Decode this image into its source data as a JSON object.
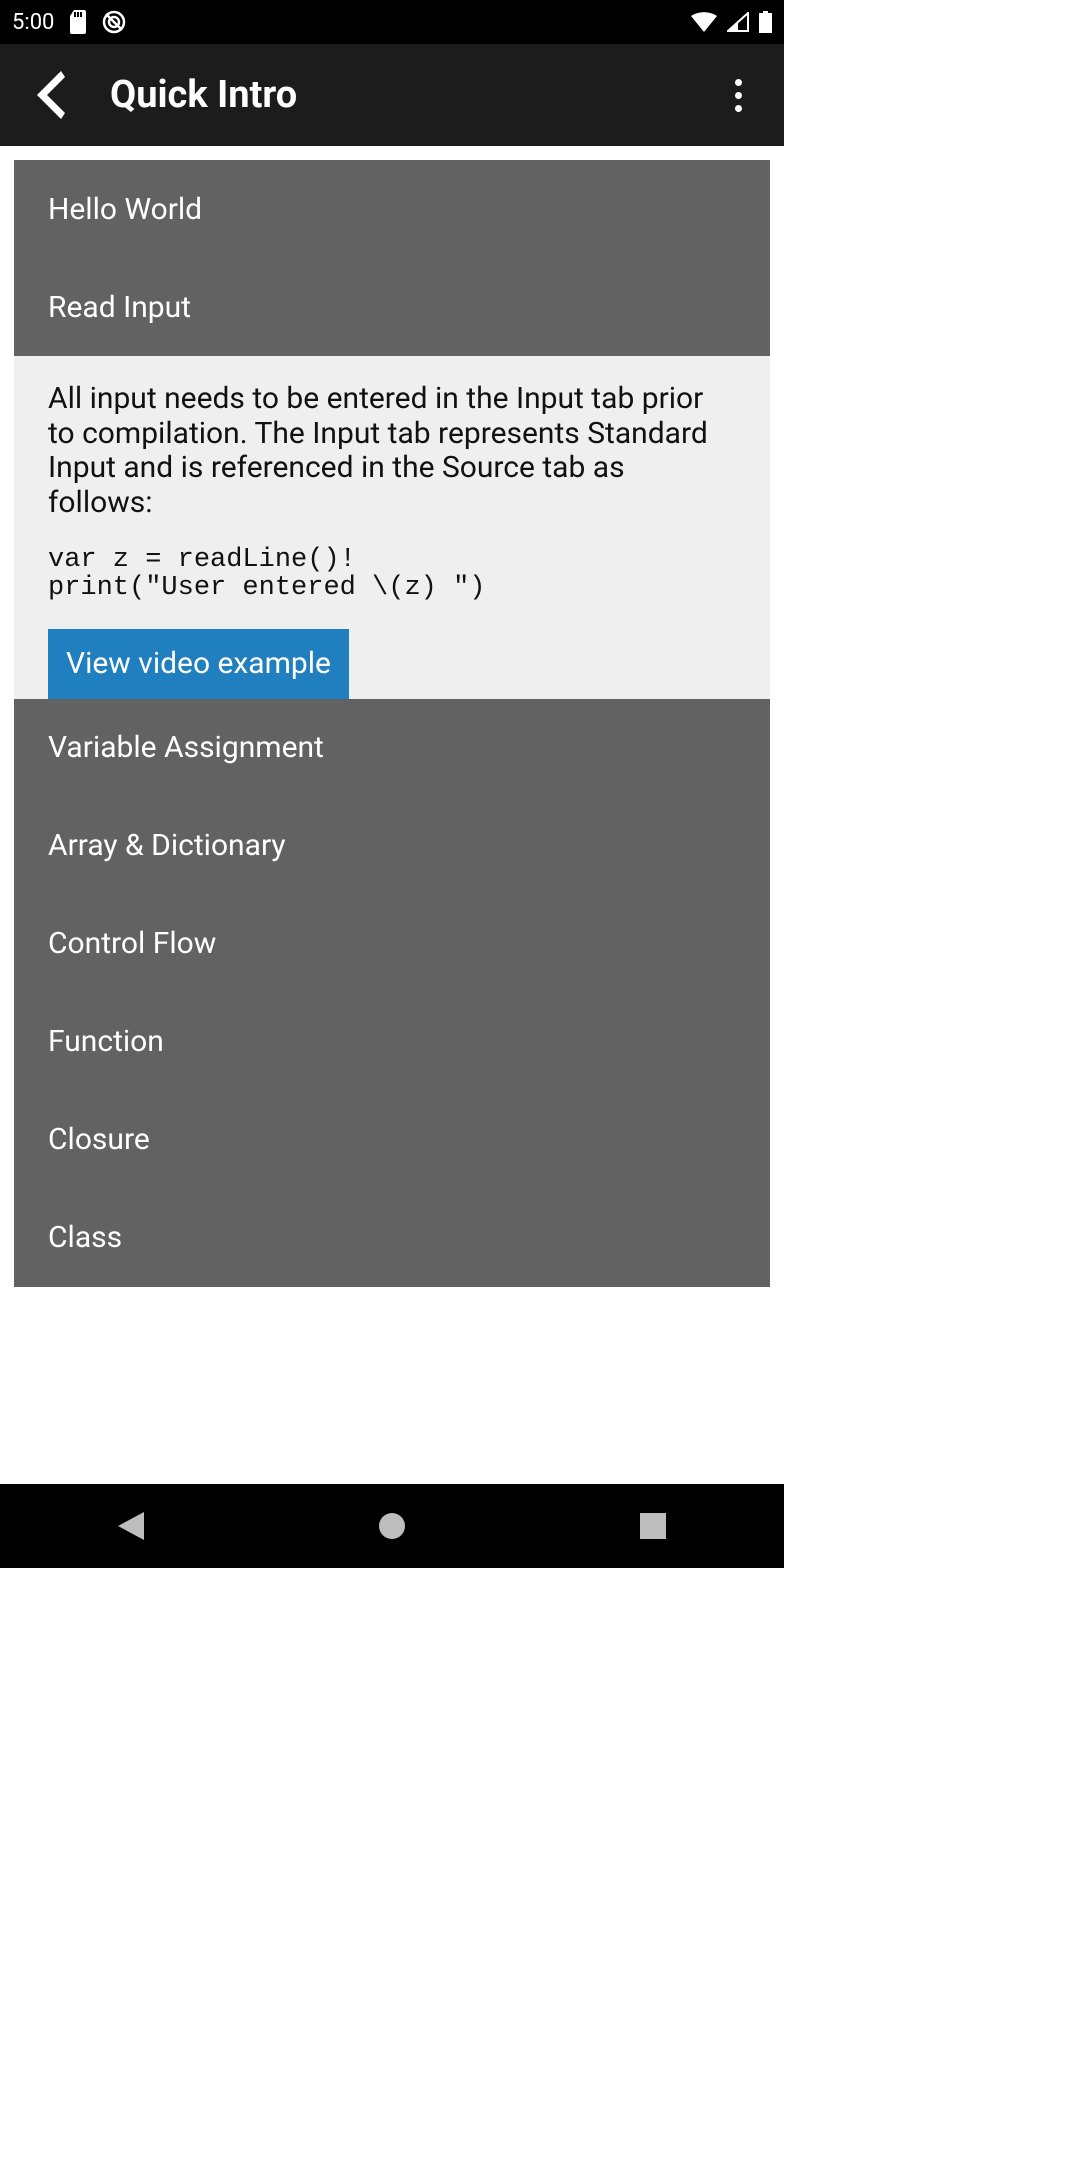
{
  "status": {
    "time": "5:00"
  },
  "header": {
    "title": "Quick Intro"
  },
  "list": {
    "item0": "Hello World",
    "item1": "Read Input",
    "item2": "Variable Assignment",
    "item3": "Array & Dictionary",
    "item4": "Control Flow",
    "item5": "Function",
    "item6": "Closure",
    "item7": "Class"
  },
  "detail": {
    "text": "All input needs to be entered in the Input tab prior to compilation. The Input tab represents Standard Input and is referenced in the Source tab as follows:",
    "code": "var z = readLine()!\nprint(\"User entered \\(z) \")",
    "button": "View video example"
  }
}
